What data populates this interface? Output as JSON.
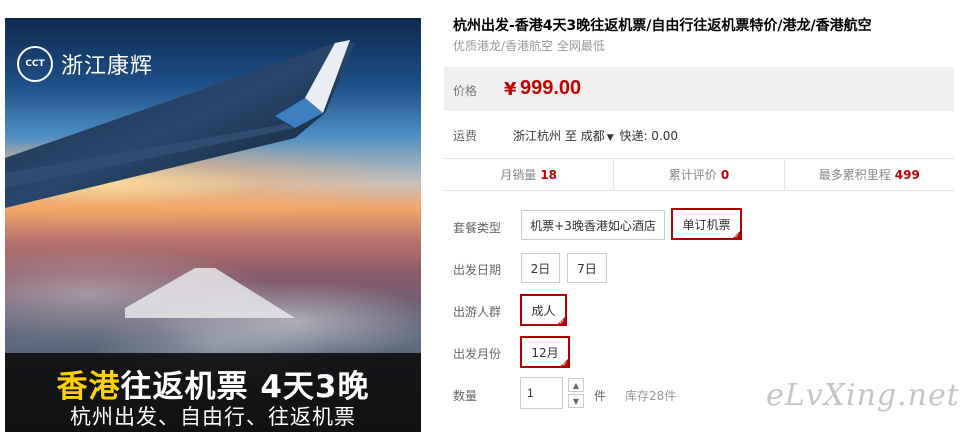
{
  "hero": {
    "brand_logo": "CCT",
    "brand_name": "浙江康辉",
    "banner_highlight": "香港",
    "banner_main": "往返机票 4天3晚",
    "banner_sub": "杭州出发、自由行、往返机票"
  },
  "product": {
    "title": "杭州出发-香港4天3晚往返机票/自由行往返机票特价/港龙/香港航空",
    "subtitle": "优质港龙/香港航空 全网最低"
  },
  "price": {
    "label": "价格",
    "currency": "¥",
    "value": "999.00",
    "color": "#c40000"
  },
  "shipping": {
    "label": "运费",
    "from": "浙江杭州",
    "to_word": "至",
    "to": "成都",
    "express": "快递: 0.00"
  },
  "stats": [
    {
      "label": "月销量",
      "value": "18"
    },
    {
      "label": "累计评价",
      "value": "0"
    },
    {
      "label": "最多累积里程",
      "value": "499"
    }
  ],
  "options": {
    "package": {
      "label": "套餐类型",
      "choices": [
        "机票+3晚香港如心酒店",
        "单订机票"
      ],
      "selected": "单订机票"
    },
    "date": {
      "label": "出发日期",
      "choices": [
        "2日",
        "7日"
      ]
    },
    "crowd": {
      "label": "出游人群",
      "choices": [
        "成人"
      ],
      "selected": "成人"
    },
    "month": {
      "label": "出发月份",
      "choices": [
        "12月"
      ],
      "selected": "12月"
    }
  },
  "quantity": {
    "label": "数量",
    "value": "1",
    "unit": "件",
    "stock": "库存28件"
  },
  "watermark": "eLvXing.net"
}
